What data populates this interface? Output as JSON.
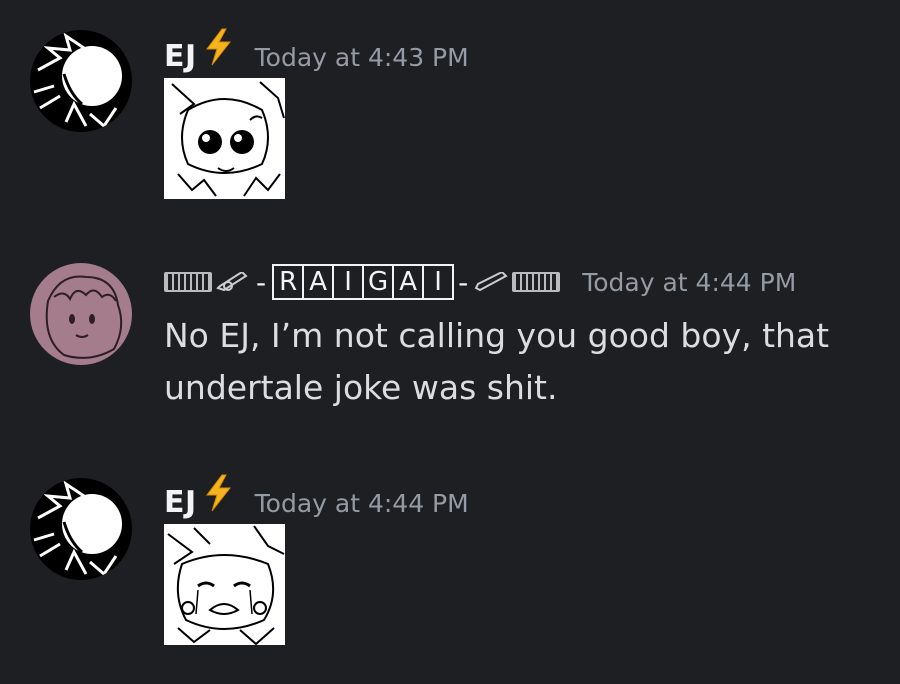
{
  "messages": [
    {
      "username": "EJ",
      "badge_icon": "lightning-bolt-emoji",
      "timestamp": "Today at 4:43 PM",
      "attachment": "cat-cute-eyes-sticker"
    },
    {
      "username_decorated": {
        "prefix_icons": [
          "keyboard-emoji",
          "writing-hand-emoji"
        ],
        "letters": [
          "R",
          "A",
          "I",
          "G",
          "A",
          "I"
        ],
        "suffix_icons": [
          "pencil-emoji",
          "keyboard-emoji"
        ],
        "dash": "-"
      },
      "timestamp": "Today at 4:44 PM",
      "text": "No EJ, I’m not calling you good boy, that undertale joke was shit."
    },
    {
      "username": "EJ",
      "badge_icon": "lightning-bolt-emoji",
      "timestamp": "Today at 4:44 PM",
      "attachment": "cat-crying-sticker"
    }
  ],
  "colors": {
    "background": "#1e1f22",
    "username": "#f2f3f5",
    "timestamp": "#949ba4",
    "message_text": "#dbdee1",
    "raigai_avatar": "#a47c8c",
    "bolt": "#f5b320"
  }
}
